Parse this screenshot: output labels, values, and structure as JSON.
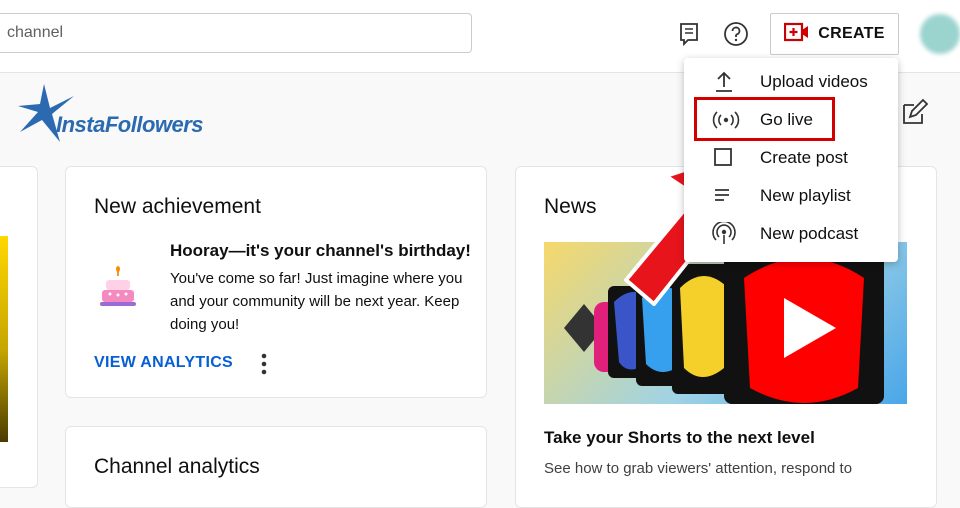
{
  "search": {
    "value": "channel",
    "placeholder": ""
  },
  "header": {
    "create_label": "CREATE"
  },
  "brand": {
    "logo_text": "InstaFollowers"
  },
  "create_menu": {
    "items": [
      {
        "label": "Upload videos",
        "icon": "upload-icon"
      },
      {
        "label": "Go live",
        "icon": "live-icon"
      },
      {
        "label": "Create post",
        "icon": "post-icon"
      },
      {
        "label": "New playlist",
        "icon": "playlist-icon"
      },
      {
        "label": "New podcast",
        "icon": "podcast-icon"
      }
    ],
    "highlighted_index": 1
  },
  "achievement_card": {
    "title": "New achievement",
    "headline": "Hooray—it's your channel's birthday!",
    "body": "You've come so far! Just imagine where you and your community will be next year. Keep doing you!",
    "link": "VIEW ANALYTICS"
  },
  "analytics_card": {
    "title": "Channel analytics"
  },
  "news_card": {
    "title": "News",
    "caption": "Take your Shorts to the next level",
    "subtext": "See how to grab viewers' attention, respond to"
  },
  "colors": {
    "accent": "#065fd4",
    "highlight": "#d40000",
    "create_icon": "#cc0000"
  }
}
